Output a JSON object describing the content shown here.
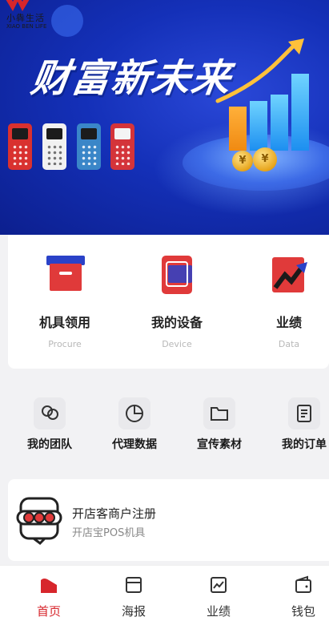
{
  "brand": {
    "name_cn": "小犇生活",
    "name_en": "XIAO BEN LIFE"
  },
  "banner": {
    "title": "财富新未来",
    "coin_symbol": "¥"
  },
  "quick": [
    {
      "title": "机具领用",
      "subtitle": "Procure",
      "icon": "box-icon"
    },
    {
      "title": "我的设备",
      "subtitle": "Device",
      "icon": "device-icon"
    },
    {
      "title": "业绩",
      "subtitle": "Data",
      "icon": "chart-trend-icon"
    }
  ],
  "menu": [
    {
      "label": "我的团队",
      "icon": "team-icon"
    },
    {
      "label": "代理数据",
      "icon": "pie-chart-icon"
    },
    {
      "label": "宣传素材",
      "icon": "folder-icon"
    },
    {
      "label": "我的订单",
      "icon": "order-icon"
    }
  ],
  "register": {
    "title": "开店客商户注册",
    "subtitle": "开店宝POS机具",
    "icon": "pos-terminal-icon"
  },
  "bottom_nav": [
    {
      "label": "首页",
      "icon": "home-icon",
      "active": true
    },
    {
      "label": "海报",
      "icon": "poster-icon",
      "active": false
    },
    {
      "label": "业绩",
      "icon": "performance-icon",
      "active": false
    },
    {
      "label": "钱包",
      "icon": "wallet-icon",
      "active": false
    }
  ],
  "colors": {
    "accent": "#d7262c",
    "banner_blue": "#1430b8",
    "background": "#f2f2f4"
  }
}
